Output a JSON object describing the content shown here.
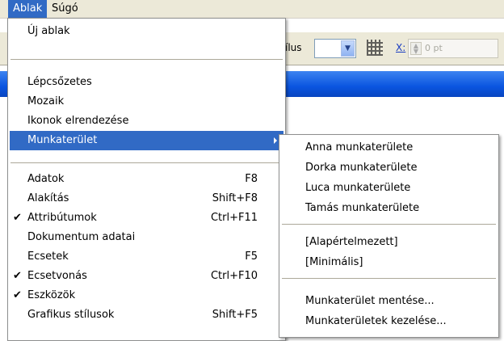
{
  "menubar": {
    "items": [
      {
        "label": "Ablak",
        "active": true
      },
      {
        "label": "Súgó",
        "active": false
      }
    ]
  },
  "toolbar": {
    "style_label": "ílus",
    "select_value": "",
    "x_label": "X:",
    "x_value": "0 pt"
  },
  "main_menu": {
    "new_window": "Új ablak",
    "cascade": "Lépcsőzetes",
    "tile": "Mozaik",
    "arrange_icons": "Ikonok elrendezése",
    "workspace": "Munkaterület",
    "items": [
      {
        "label": "Adatok",
        "shortcut": "F8",
        "checked": false
      },
      {
        "label": "Alakítás",
        "shortcut": "Shift+F8",
        "checked": false
      },
      {
        "label": "Attribútumok",
        "shortcut": "Ctrl+F11",
        "checked": true
      },
      {
        "label": "Dokumentum adatai",
        "shortcut": "",
        "checked": false
      },
      {
        "label": "Ecsetek",
        "shortcut": "F5",
        "checked": false
      },
      {
        "label": "Ecsetvonás",
        "shortcut": "Ctrl+F10",
        "checked": true
      },
      {
        "label": "Eszközök",
        "shortcut": "",
        "checked": true
      },
      {
        "label": "Grafikus stílusok",
        "shortcut": "Shift+F5",
        "checked": false
      }
    ]
  },
  "sub_menu": {
    "workspaces": [
      "Anna munkaterülete",
      "Dorka munkaterülete",
      "Luca munkaterülete",
      "Tamás munkaterülete"
    ],
    "presets": [
      "[Alapértelmezett]",
      "[Minimális]"
    ],
    "save": "Munkaterület mentése...",
    "manage": "Munkaterületek kezelése..."
  },
  "colors": {
    "highlight": "#316ac5",
    "menubar": "#ece9d8",
    "titlebar": "#0a55e0"
  }
}
